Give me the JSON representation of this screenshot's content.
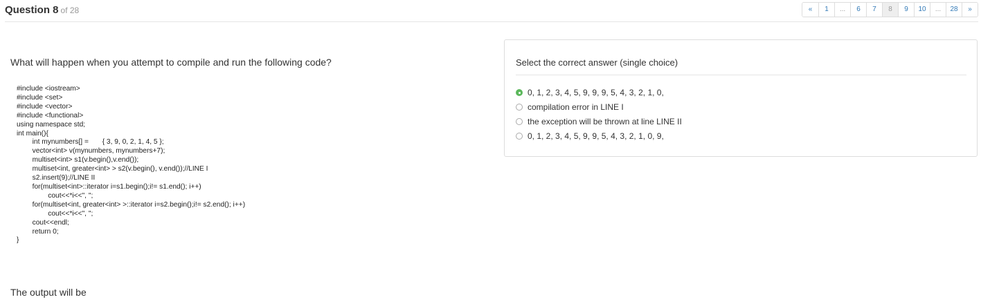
{
  "header": {
    "title": "Question 8",
    "of": "of 28"
  },
  "pagination": [
    {
      "label": "«"
    },
    {
      "label": "1"
    },
    {
      "label": "..."
    },
    {
      "label": "6"
    },
    {
      "label": "7"
    },
    {
      "label": "8",
      "active": true
    },
    {
      "label": "9"
    },
    {
      "label": "10"
    },
    {
      "label": "..."
    },
    {
      "label": "28"
    },
    {
      "label": "»"
    }
  ],
  "question": {
    "text": "What will happen when you attempt to compile and run the following code?",
    "code": "#include <iostream>\n#include <set>\n#include <vector>\n#include <functional>\nusing namespace std;\nint main(){\n        int mynumbers[] =       { 3, 9, 0, 2, 1, 4, 5 };\n        vector<int> v(mynumbers, mynumbers+7);\n        multiset<int> s1(v.begin(),v.end());\n        multiset<int, greater<int> > s2(v.begin(), v.end());//LINE I\n        s2.insert(9);//LINE II\n        for(multiset<int>::iterator i=s1.begin();i!= s1.end(); i++)\n                cout<<*i<<\", \";\n        for(multiset<int, greater<int> >::iterator i=s2.begin();i!= s2.end(); i++)\n                cout<<*i<<\", \";\n        cout<<endl;\n        return 0;\n}",
    "output_label": "The output will be"
  },
  "answers": {
    "title": "Select the correct answer (single choice)",
    "options": [
      {
        "label": "0, 1, 2, 3, 4, 5, 9, 9, 9, 5, 4, 3, 2, 1, 0,",
        "selected": true
      },
      {
        "label": "compilation error in LINE I",
        "selected": false
      },
      {
        "label": "the exception will be thrown at line LINE II",
        "selected": false
      },
      {
        "label": "0, 1, 2, 3, 4, 5, 9, 9, 5, 4, 3, 2, 1, 0, 9,",
        "selected": false
      }
    ]
  },
  "colors": {
    "link": "#337ab7",
    "selected_radio": "#5cb85c",
    "active_page_bg": "#eeeeee"
  }
}
